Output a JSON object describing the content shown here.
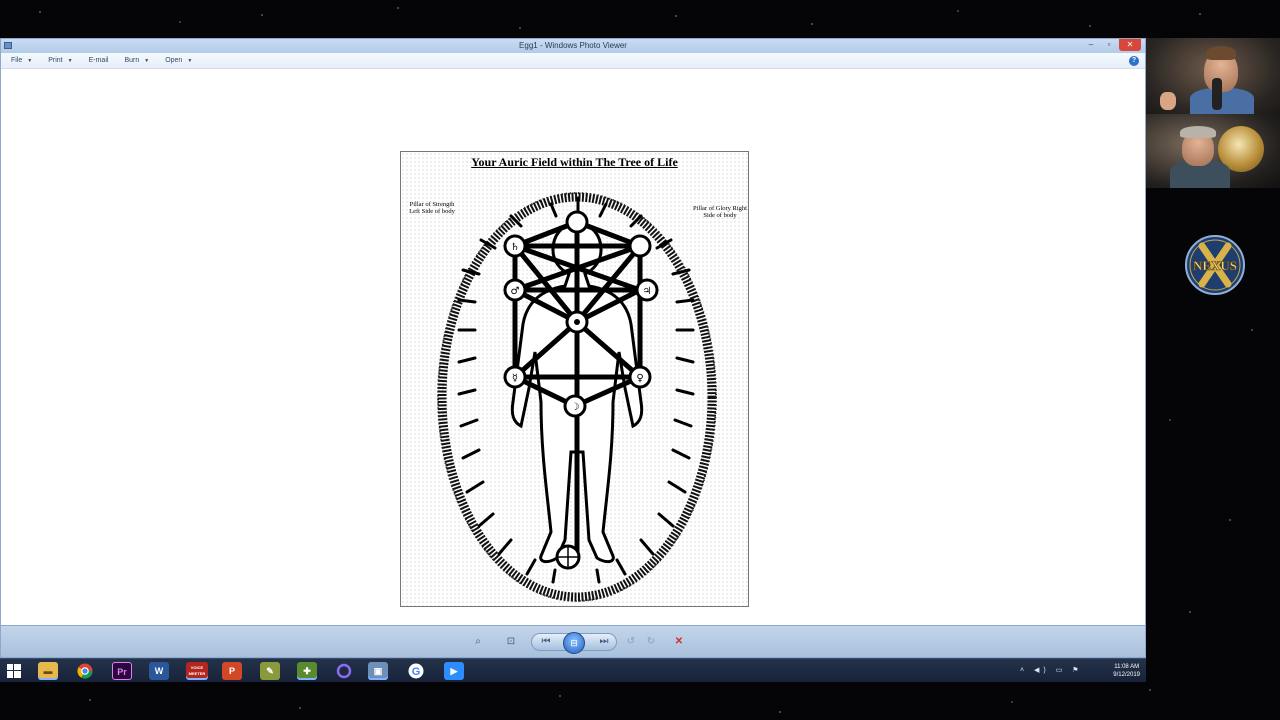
{
  "window": {
    "title": "Egg1 - Windows Photo Viewer",
    "close_glyph": "✕"
  },
  "menu": [
    {
      "label": "File",
      "has_dropdown": true
    },
    {
      "label": "Print",
      "has_dropdown": true
    },
    {
      "label": "E-mail",
      "has_dropdown": false
    },
    {
      "label": "Burn",
      "has_dropdown": true
    },
    {
      "label": "Open",
      "has_dropdown": true
    }
  ],
  "image": {
    "title": "Your Auric Field within The Tree of Life",
    "left_note": "Pillar of Strength Left Side of body",
    "right_note": "Pillar of Glory Right Side of body"
  },
  "bottom_toolbar": {
    "zoom": "⌕",
    "actual_size": "⊡",
    "previous": "⏮",
    "slideshow": "⊟",
    "next": "⏭",
    "rotate_ccw": "↺",
    "rotate_cw": "↻",
    "delete": "✕",
    "delete_color": "#d0302a"
  },
  "taskbar": {
    "icons": [
      "windows-start",
      "file-explorer",
      "chrome",
      "premiere",
      "word",
      "voicemeeter",
      "powerpoint",
      "paint",
      "app-launcher",
      "cortana",
      "photo-viewer",
      "google",
      "zoom"
    ],
    "voicemeeter_label": "VOICE MEETER",
    "time": "11:08 AM",
    "date": "9/12/2019"
  },
  "logo": {
    "text": "NEXUS"
  }
}
